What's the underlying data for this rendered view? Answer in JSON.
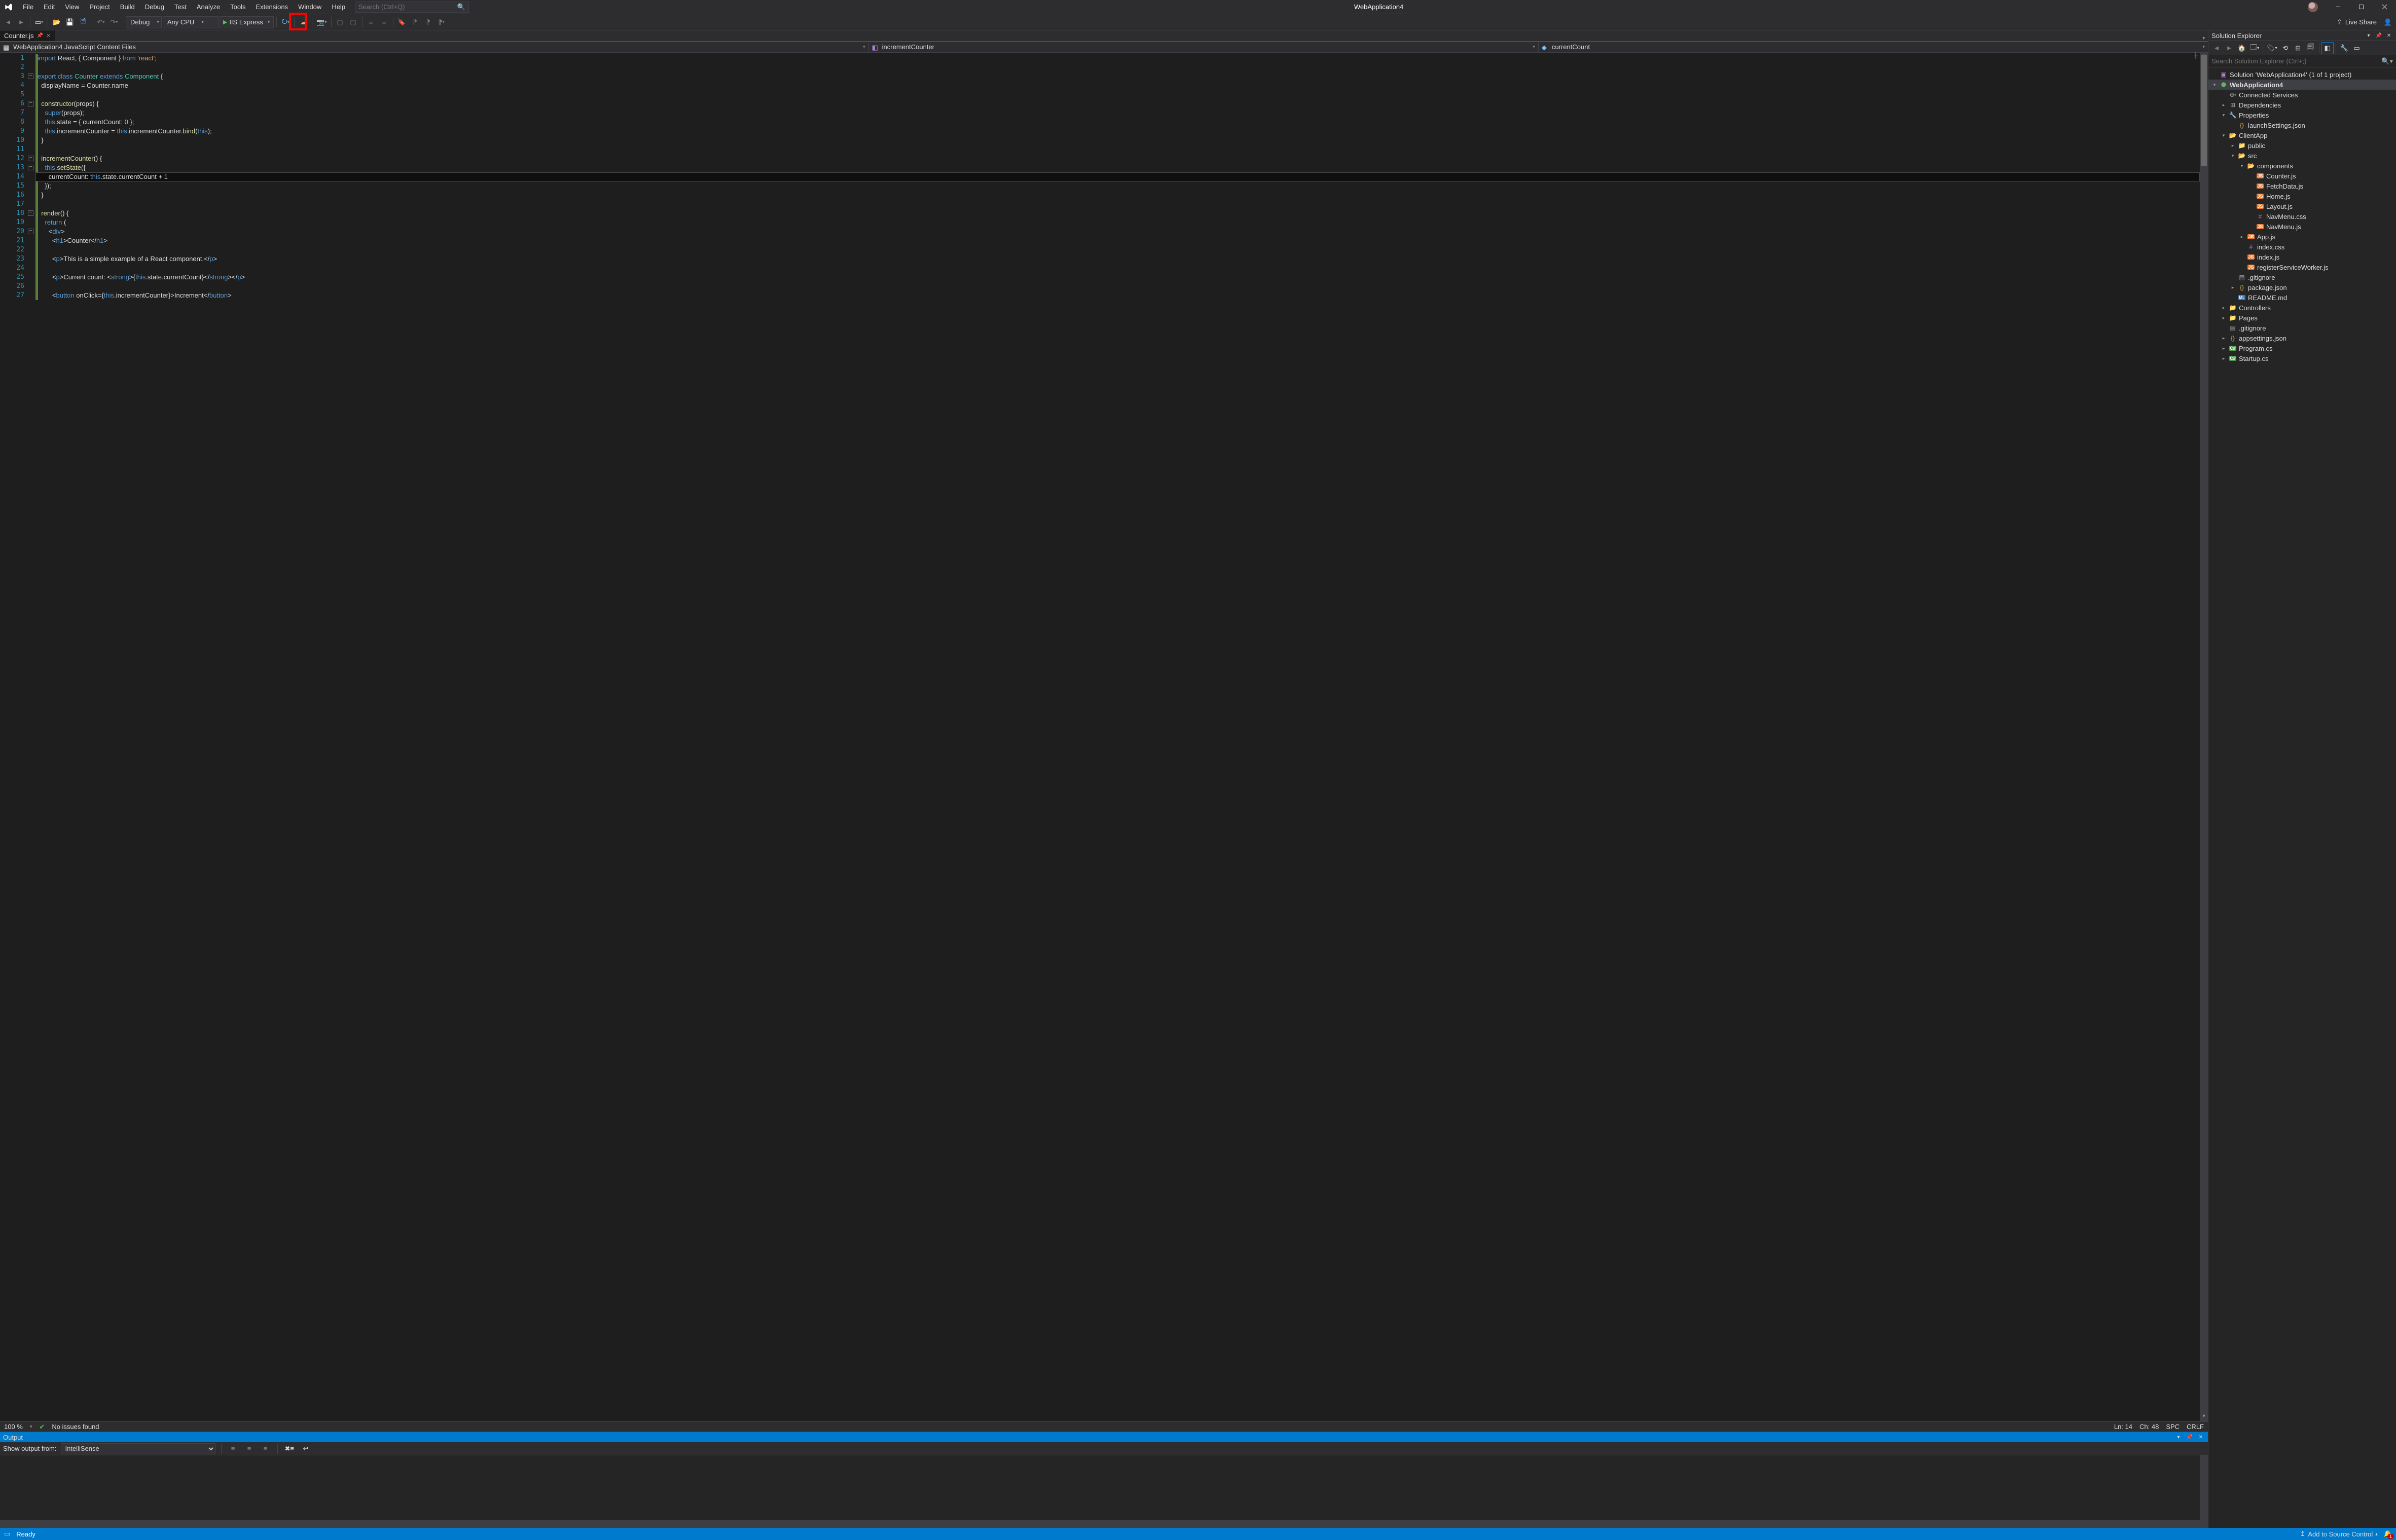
{
  "window": {
    "app_title": "WebApplication4",
    "search_placeholder": "Search (Ctrl+Q)"
  },
  "menu": [
    "File",
    "Edit",
    "View",
    "Project",
    "Build",
    "Debug",
    "Test",
    "Analyze",
    "Tools",
    "Extensions",
    "Window",
    "Help"
  ],
  "toolbar": {
    "config": "Debug",
    "platform": "Any CPU",
    "run_target": "IIS Express",
    "live_share": "Live Share"
  },
  "doc_tab": {
    "title": "Counter.js"
  },
  "nav": {
    "project": "WebApplication4 JavaScript Content Files",
    "type": "incrementCounter",
    "member": "currentCount"
  },
  "code_lines": [
    {
      "n": 1,
      "fold": "",
      "html": "<span class='kw'>import</span> React, { Component } <span class='kw'>from</span> <span class='str'>'react'</span>;"
    },
    {
      "n": 2,
      "fold": "",
      "html": ""
    },
    {
      "n": 3,
      "fold": "-",
      "html": "<span class='kw'>export</span> <span class='kw'>class</span> <span class='cls'>Counter</span> <span class='kw'>extends</span> <span class='cls'>Component</span> {"
    },
    {
      "n": 4,
      "fold": "",
      "html": "  displayName = Counter.name"
    },
    {
      "n": 5,
      "fold": "",
      "html": ""
    },
    {
      "n": 6,
      "fold": "-",
      "html": "  <span class='fn'>constructor</span>(props) {"
    },
    {
      "n": 7,
      "fold": "",
      "html": "    <span class='kw'>super</span>(props);"
    },
    {
      "n": 8,
      "fold": "",
      "html": "    <span class='kw'>this</span>.state = { currentCount: <span class='num'>0</span> };"
    },
    {
      "n": 9,
      "fold": "",
      "html": "    <span class='kw'>this</span>.incrementCounter = <span class='kw'>this</span>.incrementCounter.<span class='fn'>bind</span>(<span class='kw'>this</span>);"
    },
    {
      "n": 10,
      "fold": "",
      "html": "  }"
    },
    {
      "n": 11,
      "fold": "",
      "html": ""
    },
    {
      "n": 12,
      "fold": "-",
      "html": "  <span class='fn'>incrementCounter</span>() {"
    },
    {
      "n": 13,
      "fold": "-",
      "html": "    <span class='kw'>this</span>.<span class='fn'>setState</span>({"
    },
    {
      "n": 14,
      "fold": "",
      "current": true,
      "html": "      currentCount: <span class='kw'>this</span>.state.currentCount + <span class='num'>1</span>"
    },
    {
      "n": 15,
      "fold": "",
      "html": "    });"
    },
    {
      "n": 16,
      "fold": "",
      "html": "  }"
    },
    {
      "n": 17,
      "fold": "",
      "html": ""
    },
    {
      "n": 18,
      "fold": "-",
      "html": "  <span class='fn'>render</span>() {"
    },
    {
      "n": 19,
      "fold": "",
      "html": "    <span class='kw'>return</span> ("
    },
    {
      "n": 20,
      "fold": "-",
      "html": "      &lt;<span class='kw'>div</span>&gt;"
    },
    {
      "n": 21,
      "fold": "",
      "html": "        &lt;<span class='kw'>h1</span>&gt;Counter&lt;/<span class='kw'>h1</span>&gt;"
    },
    {
      "n": 22,
      "fold": "",
      "html": ""
    },
    {
      "n": 23,
      "fold": "",
      "html": "        &lt;<span class='kw'>p</span>&gt;This is a simple example of a React component.&lt;/<span class='kw'>p</span>&gt;"
    },
    {
      "n": 24,
      "fold": "",
      "html": ""
    },
    {
      "n": 25,
      "fold": "",
      "html": "        &lt;<span class='kw'>p</span>&gt;Current count: &lt;<span class='kw'>strong</span>&gt;{<span class='kw'>this</span>.state.currentCount}&lt;/<span class='kw'>strong</span>&gt;&lt;/<span class='kw'>p</span>&gt;"
    },
    {
      "n": 26,
      "fold": "",
      "html": ""
    },
    {
      "n": 27,
      "fold": "",
      "html": "        &lt;<span class='kw'>button</span> onClick={<span class='kw'>this</span>.incrementCounter}&gt;Increment&lt;/<span class='kw'>button</span>&gt;"
    }
  ],
  "editor_status": {
    "zoom": "100 %",
    "issues": "No issues found",
    "ln": "Ln: 14",
    "ch": "Ch: 48",
    "spc": "SPC",
    "eol": "CRLF"
  },
  "output": {
    "title": "Output",
    "show_from_label": "Show output from:",
    "show_from_value": "IntelliSense"
  },
  "solution_explorer": {
    "title": "Solution Explorer",
    "search_placeholder": "Search Solution Explorer (Ctrl+;)",
    "tree": [
      {
        "d": 0,
        "tw": "",
        "ico": "sln",
        "lbl": "Solution 'WebApplication4' (1 of 1 project)"
      },
      {
        "d": 0,
        "tw": "▾",
        "ico": "prj",
        "lbl": "WebApplication4",
        "sel": true,
        "bold": true
      },
      {
        "d": 1,
        "tw": "",
        "ico": "conn",
        "lbl": "Connected Services"
      },
      {
        "d": 1,
        "tw": "▸",
        "ico": "dep",
        "lbl": "Dependencies"
      },
      {
        "d": 1,
        "tw": "▾",
        "ico": "prop",
        "lbl": "Properties"
      },
      {
        "d": 2,
        "tw": "",
        "ico": "json",
        "lbl": "launchSettings.json"
      },
      {
        "d": 1,
        "tw": "▾",
        "ico": "fld-o",
        "lbl": "ClientApp"
      },
      {
        "d": 2,
        "tw": "▸",
        "ico": "fld",
        "lbl": "public"
      },
      {
        "d": 2,
        "tw": "▾",
        "ico": "fld-o",
        "lbl": "src"
      },
      {
        "d": 3,
        "tw": "▾",
        "ico": "fld-o",
        "lbl": "components"
      },
      {
        "d": 4,
        "tw": "",
        "ico": "js",
        "lbl": "Counter.js"
      },
      {
        "d": 4,
        "tw": "",
        "ico": "js",
        "lbl": "FetchData.js"
      },
      {
        "d": 4,
        "tw": "",
        "ico": "js",
        "lbl": "Home.js"
      },
      {
        "d": 4,
        "tw": "",
        "ico": "js",
        "lbl": "Layout.js"
      },
      {
        "d": 4,
        "tw": "",
        "ico": "css",
        "lbl": "NavMenu.css"
      },
      {
        "d": 4,
        "tw": "",
        "ico": "js",
        "lbl": "NavMenu.js"
      },
      {
        "d": 3,
        "tw": "▸",
        "ico": "js",
        "lbl": "App.js"
      },
      {
        "d": 3,
        "tw": "",
        "ico": "css",
        "lbl": "index.css"
      },
      {
        "d": 3,
        "tw": "",
        "ico": "js",
        "lbl": "index.js"
      },
      {
        "d": 3,
        "tw": "",
        "ico": "js",
        "lbl": "registerServiceWorker.js"
      },
      {
        "d": 2,
        "tw": "",
        "ico": "git",
        "lbl": ".gitignore"
      },
      {
        "d": 2,
        "tw": "▸",
        "ico": "json",
        "lbl": "package.json"
      },
      {
        "d": 2,
        "tw": "",
        "ico": "md",
        "lbl": "README.md"
      },
      {
        "d": 1,
        "tw": "▸",
        "ico": "fld",
        "lbl": "Controllers"
      },
      {
        "d": 1,
        "tw": "▸",
        "ico": "fld",
        "lbl": "Pages"
      },
      {
        "d": 1,
        "tw": "",
        "ico": "git",
        "lbl": ".gitignore"
      },
      {
        "d": 1,
        "tw": "▸",
        "ico": "json",
        "lbl": "appsettings.json"
      },
      {
        "d": 1,
        "tw": "▸",
        "ico": "cs",
        "lbl": "Program.cs"
      },
      {
        "d": 1,
        "tw": "▸",
        "ico": "cs",
        "lbl": "Startup.cs"
      }
    ]
  },
  "statusbar": {
    "ready": "Ready",
    "source_control": "Add to Source Control",
    "notifications": "1"
  }
}
